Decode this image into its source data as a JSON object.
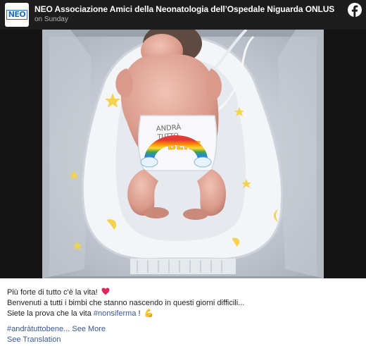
{
  "post": {
    "author": "NEO Associazione Amici della Neonatologia dell’Ospedale Niguarda ONLUS",
    "timestamp": "on Sunday",
    "avatar_text": "NEO",
    "platform_icon": "facebook-icon",
    "photo_text": {
      "diaper_line1": "ANDRÀ",
      "diaper_line2": "TUTTO",
      "diaper_line3": "BENE"
    },
    "caption": {
      "line1": "Più forte di tutto c'è la vita!",
      "line1_emoji": "heart-icon",
      "line2": "Benvenuti a tutti i bimbi che stanno nascendo in questi giorni difficili...",
      "line3_prefix": "Siete la prova che la vita ",
      "line3_hashtag": "#nonsiferma",
      "line3_suffix": " !",
      "line3_emoji": "💪"
    },
    "hashtag_preview": "#andràtuttobene...",
    "see_more": "See More",
    "see_translation": "See Translation"
  },
  "colors": {
    "header_bg": "#1d1d1d",
    "link": "#385898",
    "text": "#1c1e21",
    "heart": "#e0245e"
  }
}
